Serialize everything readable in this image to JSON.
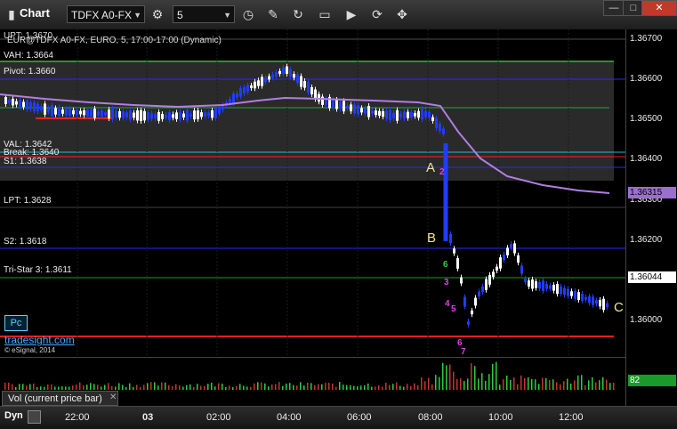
{
  "window": {
    "title": "Chart",
    "symbol": "TDFX A0-FX",
    "interval": "5",
    "min_label": "—",
    "max_label": "□",
    "close_label": "✕"
  },
  "chart_header": "EUR@TDFX A0-FX, EURO, 5, 17:00-17:00 (Dynamic)",
  "upt_label": "UPT: 1.3670",
  "levels": {
    "vah": "VAH: 1.3664",
    "pivot": "Pivot: 1.3660",
    "val": "VAL: 1.3642",
    "break": "Break: 1.3640",
    "s1": "S1: 1.3638",
    "lpt": "LPT: 1.3628",
    "s2": "S2: 1.3618",
    "tristar": "Tri-Star 3: 1.3611"
  },
  "price_axis": [
    "1.36700",
    "1.36600",
    "1.36500",
    "1.36400",
    "1.36300",
    "1.36200",
    "1.36100",
    "1.36000"
  ],
  "current_price": "1.36044",
  "ma_price": "1.36315",
  "vol_value": "82",
  "markers": {
    "a": "A",
    "b": "B",
    "c": "C"
  },
  "counts": [
    "2",
    "3",
    "4",
    "5",
    "6",
    "7",
    "6"
  ],
  "pc_badge": "Pc",
  "brand": "tradesight.com",
  "copyright": "© eSignal, 2014",
  "vol_label": "Vol (current price bar)",
  "vol_close": "✕",
  "dyn_label": "Dyn",
  "time_axis": [
    "22:00",
    "03",
    "02:00",
    "04:00",
    "06:00",
    "08:00",
    "10:00",
    "12:00"
  ],
  "colors": {
    "down_candle": "#1f3cff",
    "up_candle": "#ffffff",
    "ma": "#b07fe0",
    "vah_line": "#2ecc40",
    "pivot_line": "#1a1aff",
    "val_line": "#20c0c0",
    "s_line": "#1a1aff",
    "red_line": "#ff2020"
  }
}
